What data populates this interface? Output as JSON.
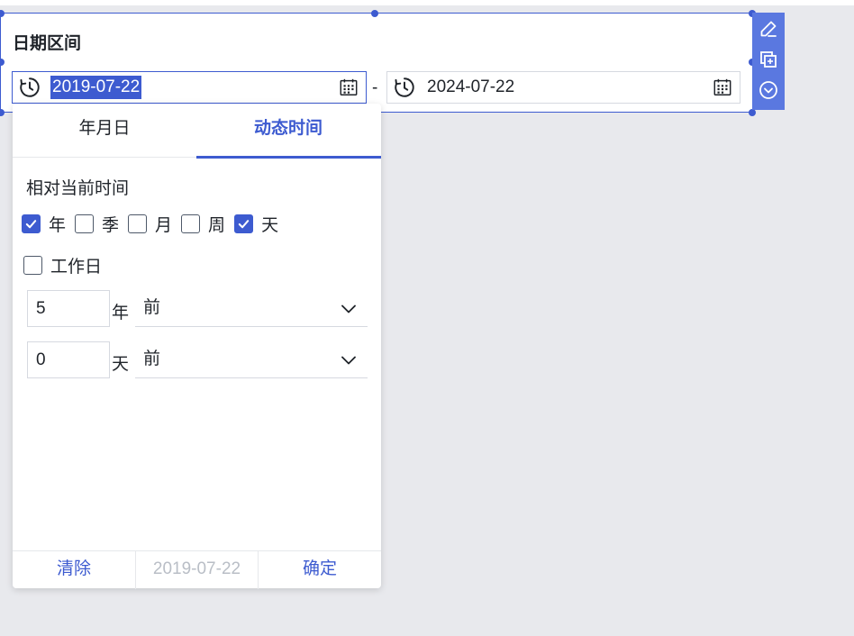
{
  "widget": {
    "title": "日期区间",
    "start_date": "2019-07-22",
    "separator": "-",
    "end_date": "2024-07-22"
  },
  "toolbar": {
    "icons": [
      "edit-icon",
      "copy-icon",
      "chevron-circle-down-icon"
    ]
  },
  "popup": {
    "tabs": [
      {
        "label": "年月日",
        "selected": false
      },
      {
        "label": "动态时间",
        "selected": true
      }
    ],
    "section_title": "相对当前时间",
    "granularity": [
      {
        "label": "年",
        "checked": true
      },
      {
        "label": "季",
        "checked": false
      },
      {
        "label": "月",
        "checked": false
      },
      {
        "label": "周",
        "checked": false
      },
      {
        "label": "天",
        "checked": true
      }
    ],
    "workday": {
      "label": "工作日",
      "checked": false
    },
    "offsets": [
      {
        "value": "5",
        "unit": "年",
        "direction": "前"
      },
      {
        "value": "0",
        "unit": "天",
        "direction": "前"
      }
    ],
    "footer": {
      "clear_label": "清除",
      "preview_date": "2019-07-22",
      "confirm_label": "确定"
    }
  },
  "colors": {
    "accent": "#3d5bd0",
    "toolbar_bg": "#5a78e0",
    "canvas_bg": "#e8e9ed"
  }
}
